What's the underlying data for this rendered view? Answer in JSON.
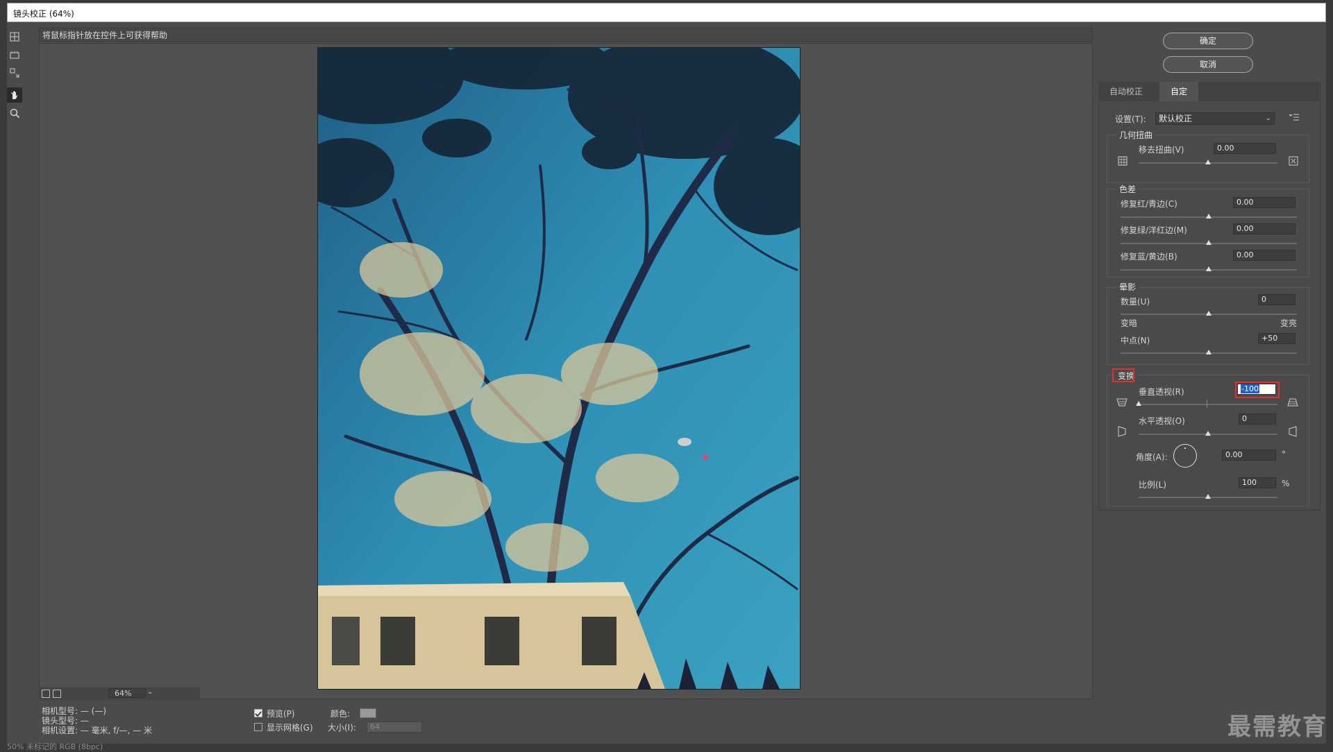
{
  "window": {
    "title": "镜头校正 (64%)"
  },
  "help": {
    "text": "将鼠标指针放在控件上可获得帮助"
  },
  "buttons": {
    "ok": "确定",
    "cancel": "取消"
  },
  "tabs": [
    {
      "label": "自动校正"
    },
    {
      "label": "自定"
    }
  ],
  "settings": {
    "label": "设置(T):",
    "value": "默认校正",
    "menu_icon": "menu-lines-icon"
  },
  "geometric": {
    "title": "几何扭曲",
    "remove_distortion": {
      "label": "移去扭曲(V)",
      "value": "0.00",
      "level": 0.5
    }
  },
  "chromatic": {
    "title": "色差",
    "red_cyan": {
      "label": "修复红/青边(C)",
      "value": "0.00",
      "level": 0.5
    },
    "green_magenta": {
      "label": "修复绿/洋红边(M)",
      "value": "0.00",
      "level": 0.5
    },
    "blue_yellow": {
      "label": "修复蓝/黄边(B)",
      "value": "0.00",
      "level": 0.5
    }
  },
  "vignette": {
    "title": "晕影",
    "amount": {
      "label": "数量(U)",
      "value": "0",
      "level": 0.5
    },
    "darken": "变暗",
    "lighten": "变亮",
    "midpoint": {
      "label": "中点(N)",
      "value": "+50",
      "level": 0.5
    }
  },
  "transform": {
    "title": "变换",
    "vertical": {
      "label": "垂直透视(R)",
      "value": "-100",
      "level": 0.0
    },
    "horizontal": {
      "label": "水平透视(O)",
      "value": "0",
      "level": 0.5
    },
    "angle": {
      "label": "角度(A):",
      "value": "0.00",
      "unit": "°"
    },
    "scale": {
      "label": "比例(L)",
      "value": "100",
      "unit": "%",
      "level": 0.5
    }
  },
  "zoom": {
    "value": "64%"
  },
  "info": {
    "camera_model": "相机型号: — (—)",
    "lens_model": "镜头型号: —",
    "camera_settings": "相机设置: — 毫米, f/—, — 米"
  },
  "options": {
    "preview": {
      "label": "预览(P)",
      "checked": true
    },
    "show_grid": {
      "label": "显示网格(G)",
      "checked": false
    },
    "color_label": "颜色:",
    "size_label": "大小(I):",
    "size_value": "64"
  },
  "watermark": "最需教育",
  "statusbar": "50%  未标记的 RGB (8bpc)",
  "colors": {
    "highlight": "#e1302f",
    "selection": "#1f5fd1"
  }
}
